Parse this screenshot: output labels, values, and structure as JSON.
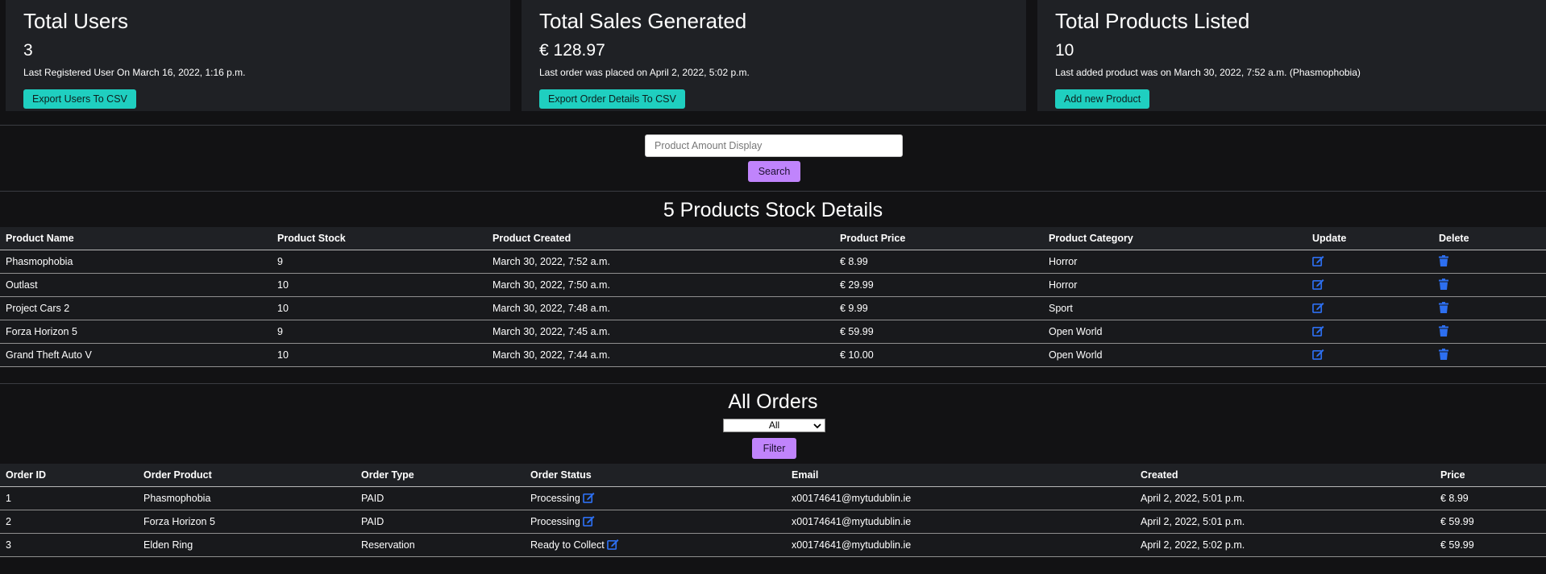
{
  "cards": [
    {
      "title": "Total Users",
      "value": "3",
      "note": "Last Registered User On March 16, 2022, 1:16 p.m.",
      "button": "Export Users To CSV"
    },
    {
      "title": "Total Sales Generated",
      "value": "€ 128.97",
      "note": "Last order was placed on April 2, 2022, 5:02 p.m.",
      "button": "Export Order Details To CSV"
    },
    {
      "title": "Total Products Listed",
      "value": "10",
      "note": "Last added product was on March 30, 2022, 7:52 a.m. (Phasmophobia)",
      "button": "Add new Product"
    }
  ],
  "search": {
    "placeholder": "Product Amount Display",
    "button": "Search"
  },
  "products": {
    "title": "5 Products Stock Details",
    "headers": [
      "Product Name",
      "Product Stock",
      "Product Created",
      "Product Price",
      "Product Category",
      "Update",
      "Delete"
    ],
    "rows": [
      [
        "Phasmophobia",
        "9",
        "March 30, 2022, 7:52 a.m.",
        "€ 8.99",
        "Horror"
      ],
      [
        "Outlast",
        "10",
        "March 30, 2022, 7:50 a.m.",
        "€ 29.99",
        "Horror"
      ],
      [
        "Project Cars 2",
        "10",
        "March 30, 2022, 7:48 a.m.",
        "€ 9.99",
        "Sport"
      ],
      [
        "Forza Horizon 5",
        "9",
        "March 30, 2022, 7:45 a.m.",
        "€ 59.99",
        "Open World"
      ],
      [
        "Grand Theft Auto V",
        "10",
        "March 30, 2022, 7:44 a.m.",
        "€ 10.00",
        "Open World"
      ]
    ]
  },
  "orders": {
    "title": "All Orders",
    "filter_selected": "All",
    "filter_button": "Filter",
    "headers": [
      "Order ID",
      "Order Product",
      "Order Type",
      "Order Status",
      "Email",
      "Created",
      "Price"
    ],
    "rows": [
      [
        "1",
        "Phasmophobia",
        "PAID",
        "Processing",
        "x00174641@mytudublin.ie",
        "April 2, 2022, 5:01 p.m.",
        "€ 8.99"
      ],
      [
        "2",
        "Forza Horizon 5",
        "PAID",
        "Processing",
        "x00174641@mytudublin.ie",
        "April 2, 2022, 5:01 p.m.",
        "€ 59.99"
      ],
      [
        "3",
        "Elden Ring",
        "Reservation",
        "Ready to Collect",
        "x00174641@mytudublin.ie",
        "April 2, 2022, 5:02 p.m.",
        "€ 59.99"
      ]
    ]
  },
  "colors": {
    "accent_teal": "#1fcfc0",
    "accent_purple": "#c084fc",
    "icon_blue": "#2d6ff0"
  },
  "icons": {
    "update": "edit-icon",
    "delete": "trash-icon"
  }
}
